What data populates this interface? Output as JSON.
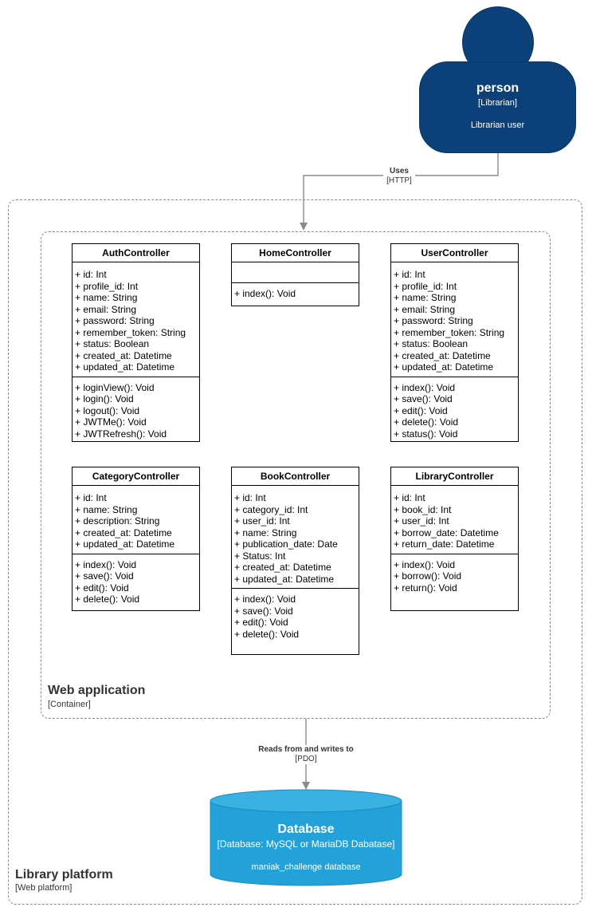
{
  "person": {
    "title": "person",
    "type": "[Librarian]",
    "description": "Librarian user"
  },
  "rel_uses": {
    "label": "Uses",
    "tech": "[HTTP]"
  },
  "rel_db": {
    "label": "Reads from and writes to",
    "tech": "[PDO]"
  },
  "platform": {
    "title": "Library platform",
    "subtitle": "[Web platform]"
  },
  "webapp": {
    "title": "Web application",
    "subtitle": "[Container]"
  },
  "database": {
    "title": "Database",
    "type": "[Database: MySQL or MariaDB Dabatase]",
    "description": "maniak_challenge database"
  },
  "classes": {
    "auth": {
      "name": "AuthController",
      "attributes": [
        "+ id: Int",
        "+ profile_id: Int",
        "+ name: String",
        "+ email: String",
        "+ password: String",
        "+ remember_token: String",
        "+ status: Boolean",
        "+ created_at: Datetime",
        "+ updated_at: Datetime"
      ],
      "operations": [
        "+ loginView(): Void",
        "+ login(): Void",
        "+ logout(): Void",
        "+ JWTMe(): Void",
        "+ JWTRefresh(): Void"
      ]
    },
    "home": {
      "name": "HomeController",
      "attributes": [],
      "operations": [
        "+ index(): Void"
      ]
    },
    "user": {
      "name": "UserController",
      "attributes": [
        "+ id: Int",
        "+ profile_id: Int",
        "+ name: String",
        "+ email: String",
        "+ password: String",
        "+ remember_token: String",
        "+ status: Boolean",
        "+ created_at: Datetime",
        "+ updated_at: Datetime"
      ],
      "operations": [
        "+ index(): Void",
        "+ save(): Void",
        "+ edit(): Void",
        "+ delete(): Void",
        "+ status(): Void"
      ]
    },
    "category": {
      "name": "CategoryController",
      "attributes": [
        "+ id: Int",
        "+ name: String",
        "+ description: String",
        "+ created_at: Datetime",
        "+ updated_at: Datetime"
      ],
      "operations": [
        "+ index(): Void",
        "+ save(): Void",
        "+ edit(): Void",
        "+ delete(): Void"
      ]
    },
    "book": {
      "name": "BookController",
      "attributes": [
        "+ id: Int",
        "+ category_id: Int",
        "+ user_id: Int",
        "+ name: String",
        "+ publication_date: Date",
        "+ Status: Int",
        "+ created_at: Datetime",
        "+ updated_at: Datetime"
      ],
      "operations": [
        "+ index(): Void",
        "+ save(): Void",
        "+ edit(): Void",
        "+ delete(): Void"
      ]
    },
    "library": {
      "name": "LibraryController",
      "attributes": [
        "+ id: Int",
        "+ book_id: Int",
        "+ user_id: Int",
        "+ borrow_date: Datetime",
        "+ return_date: Datetime"
      ],
      "operations": [
        "+ index(): Void",
        "+ borrow(): Void",
        "+ return(): Void"
      ]
    }
  },
  "colors": {
    "person": "#0b4178",
    "database": "#23a2d9",
    "database_top": "#3bb0e2"
  }
}
